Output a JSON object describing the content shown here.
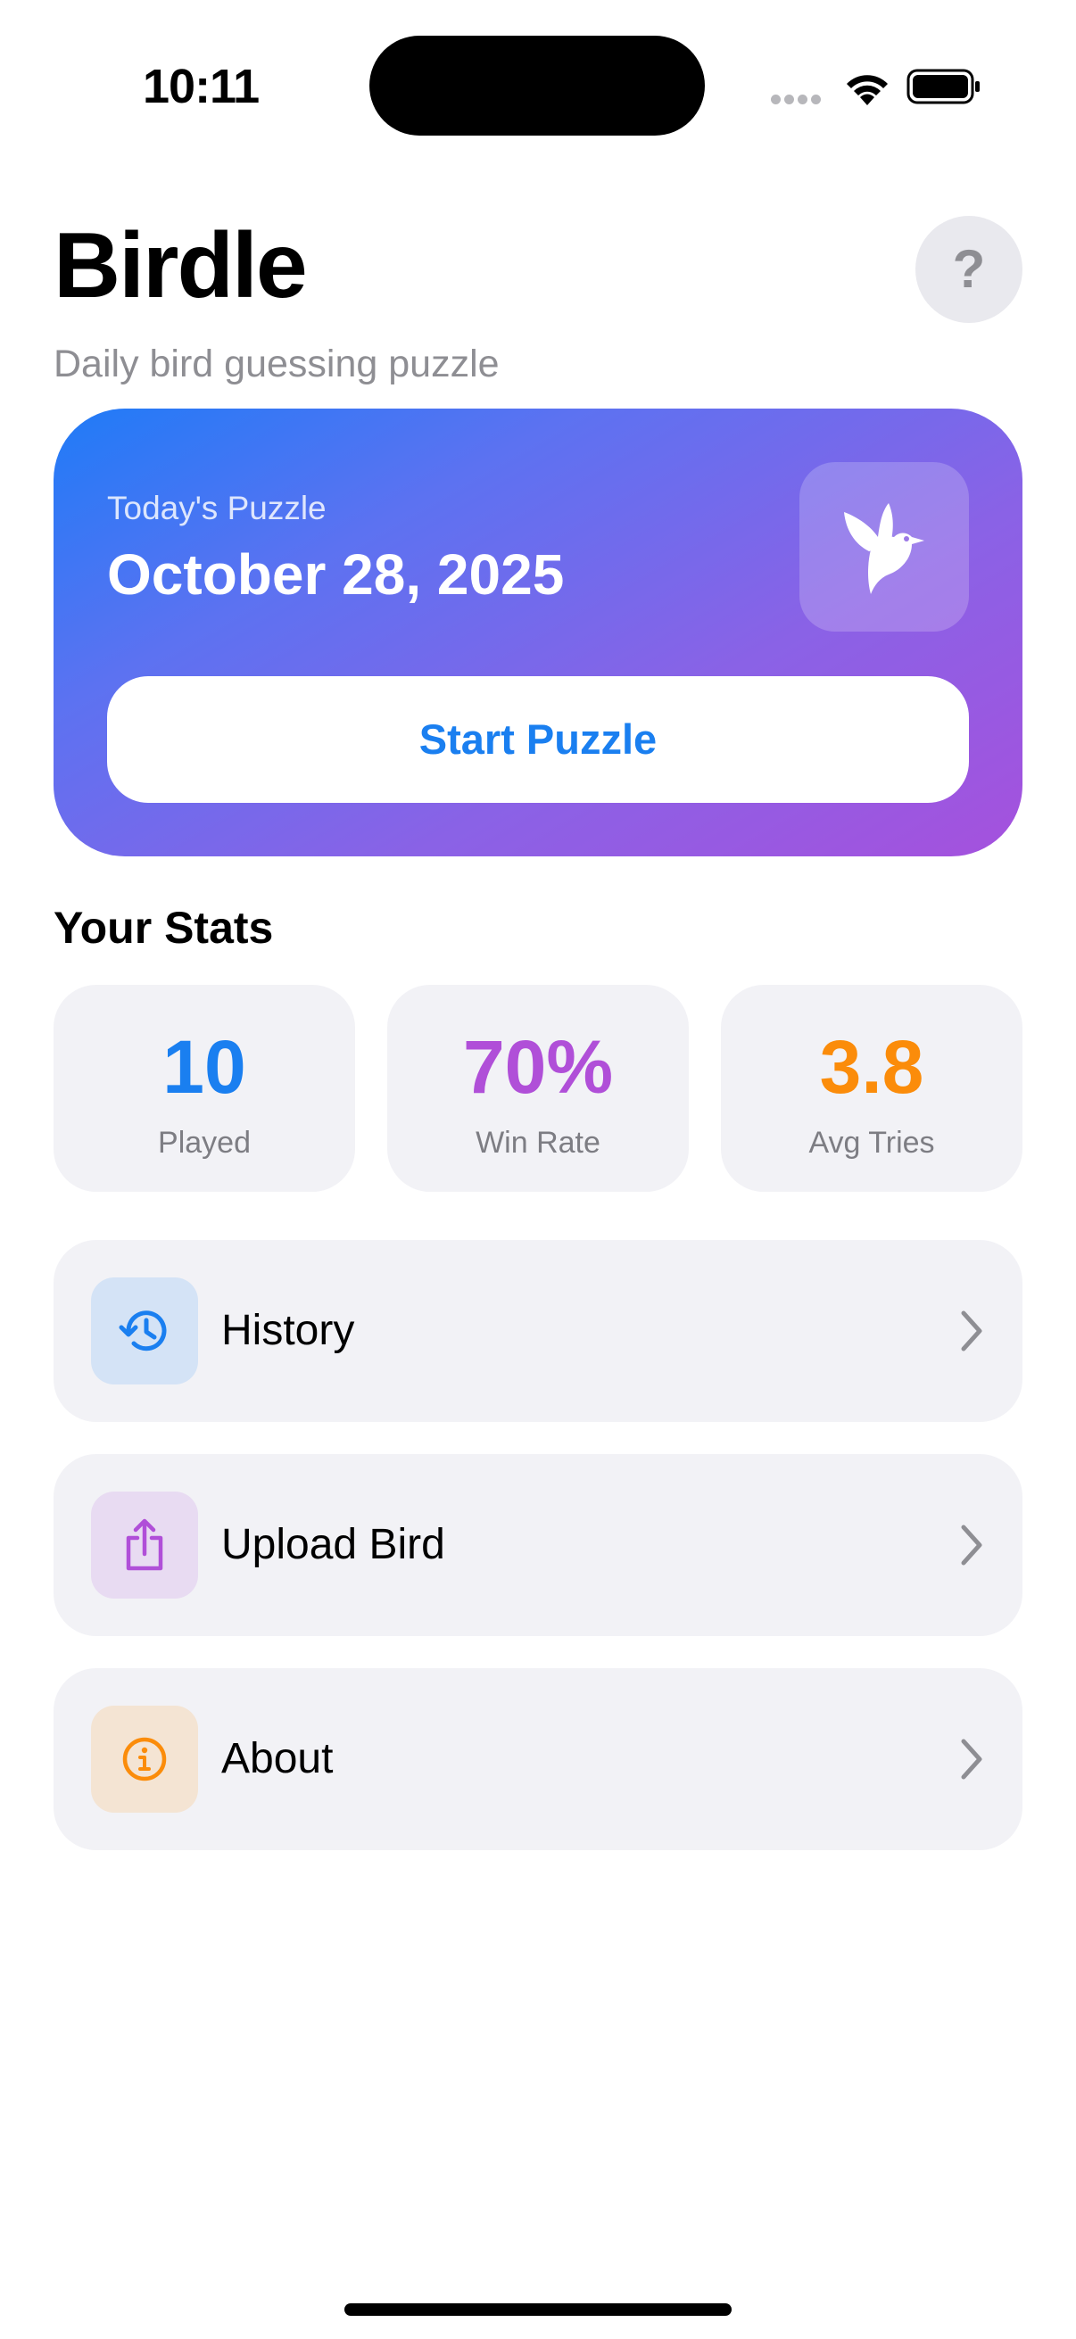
{
  "status_bar": {
    "time": "10:11"
  },
  "header": {
    "title": "Birdle",
    "subtitle": "Daily bird guessing puzzle",
    "help_label": "?"
  },
  "hero": {
    "label": "Today's Puzzle",
    "date": "October 28, 2025",
    "icon": "bird-icon",
    "start_label": "Start Puzzle"
  },
  "stats": {
    "heading": "Your Stats",
    "items": [
      {
        "value": "10",
        "label": "Played",
        "color": "#1a7ff0"
      },
      {
        "value": "70%",
        "label": "Win Rate",
        "color": "#b04fd8"
      },
      {
        "value": "3.8",
        "label": "Avg Tries",
        "color": "#fb8c0a"
      }
    ]
  },
  "menu": {
    "items": [
      {
        "label": "History",
        "icon": "history-icon",
        "accent": "#1a7ff0"
      },
      {
        "label": "Upload Bird",
        "icon": "share-upload-icon",
        "accent": "#b04fd8"
      },
      {
        "label": "About",
        "icon": "info-icon",
        "accent": "#fb8c0a"
      }
    ]
  },
  "colors": {
    "accent_blue": "#1a7ff0",
    "accent_purple": "#b04fd8",
    "accent_orange": "#fb8c0a",
    "gradient_start": "#1f7bf7",
    "gradient_end": "#a551dd",
    "card_background": "#f2f2f6"
  }
}
